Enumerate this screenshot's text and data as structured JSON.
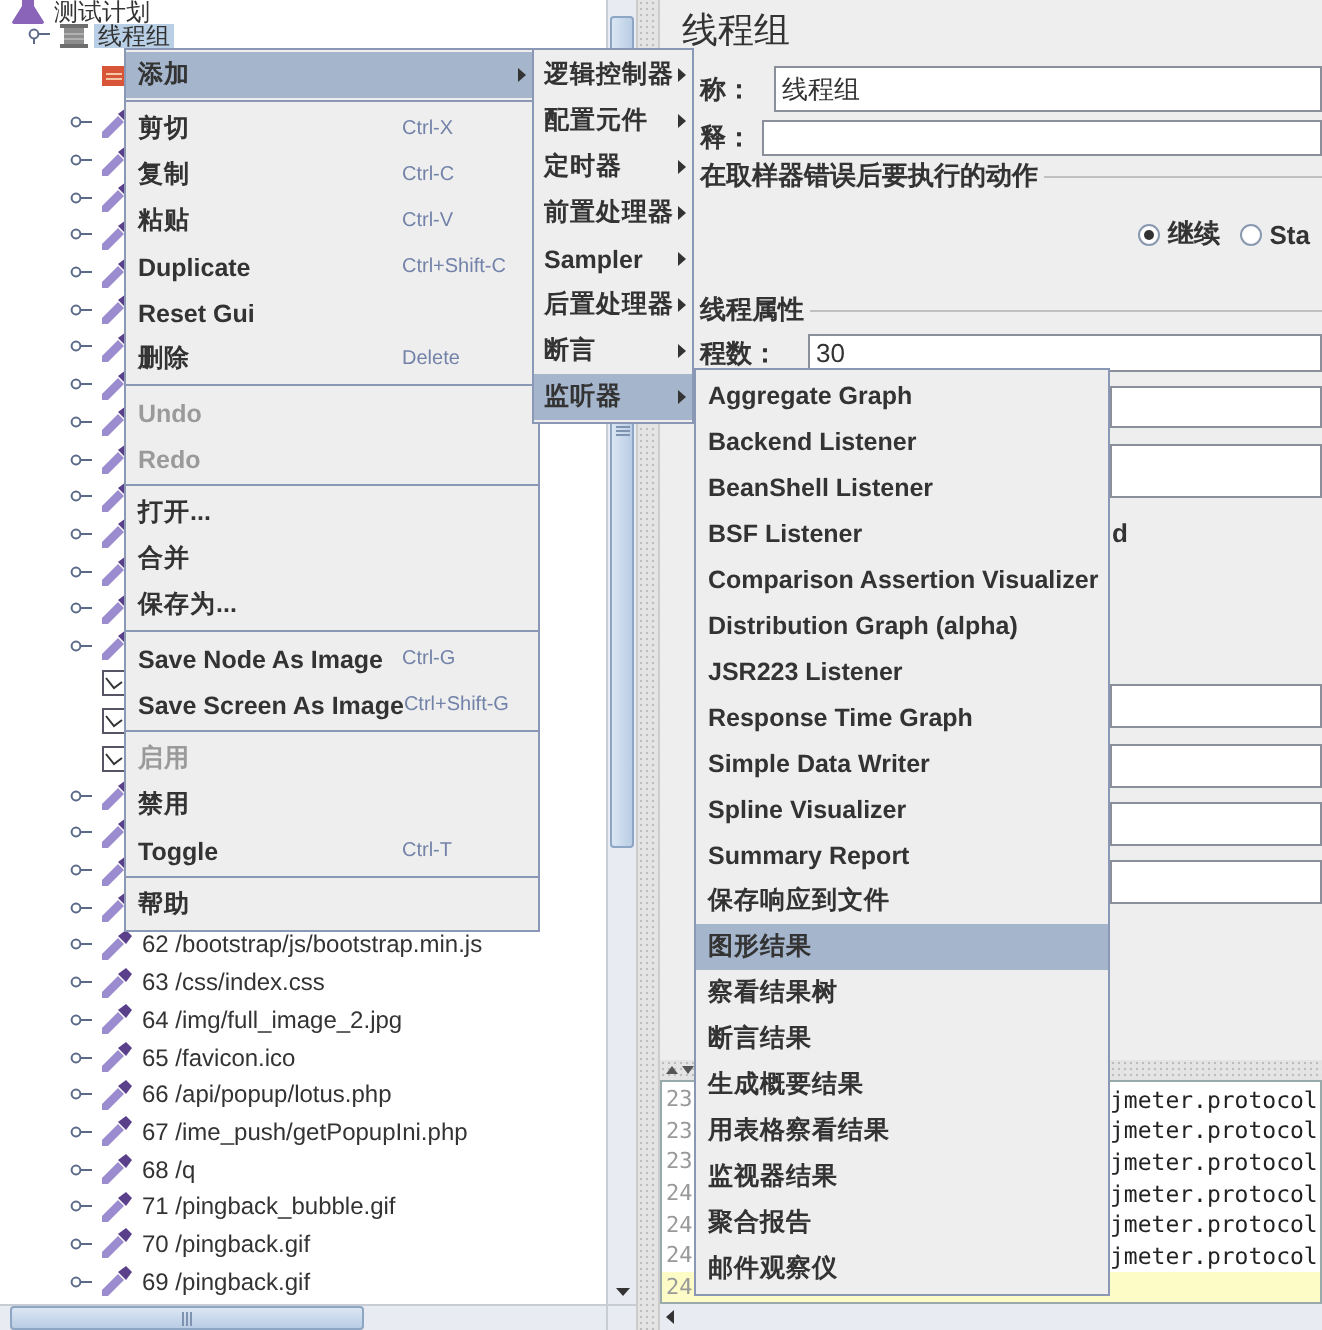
{
  "tree": {
    "root": {
      "label": "测试计划",
      "kind": "plan",
      "selected": false,
      "children": [
        {
          "label": "线程组",
          "kind": "thread_group",
          "selected": true,
          "expanded": true,
          "children": [
            {
              "kind": "config",
              "selected": false
            },
            {
              "kind": "sampler",
              "selected": false,
              "expanded": false
            },
            {
              "kind": "sampler",
              "selected": false,
              "expanded": false
            },
            {
              "kind": "sampler",
              "selected": false,
              "expanded": false
            },
            {
              "kind": "sampler",
              "selected": false,
              "expanded": false
            },
            {
              "kind": "sampler",
              "selected": false,
              "expanded": false
            },
            {
              "kind": "sampler",
              "selected": false,
              "expanded": false
            },
            {
              "kind": "sampler",
              "selected": false,
              "expanded": false
            },
            {
              "kind": "sampler",
              "selected": false,
              "expanded": false
            },
            {
              "kind": "sampler",
              "selected": false,
              "expanded": false
            },
            {
              "kind": "sampler",
              "selected": false,
              "expanded": false
            },
            {
              "kind": "sampler",
              "selected": false,
              "expanded": false
            },
            {
              "kind": "sampler",
              "selected": false,
              "expanded": false
            },
            {
              "kind": "sampler",
              "selected": false,
              "expanded": false
            },
            {
              "kind": "sampler",
              "selected": false,
              "expanded": false
            },
            {
              "kind": "sampler",
              "selected": false,
              "expanded": false
            },
            {
              "kind": "listener",
              "selected": false
            },
            {
              "kind": "listener",
              "selected": false
            },
            {
              "kind": "listener",
              "selected": false
            },
            {
              "kind": "sampler",
              "selected": false,
              "expanded": false
            },
            {
              "kind": "sampler",
              "selected": false,
              "expanded": false
            },
            {
              "kind": "sampler",
              "selected": false,
              "expanded": false
            },
            {
              "kind": "sampler",
              "selected": false,
              "expanded": false
            },
            {
              "kind": "sampler",
              "label": "62 /bootstrap/js/bootstrap.min.js",
              "selected": false,
              "expanded": false
            },
            {
              "kind": "sampler",
              "label": "63 /css/index.css",
              "selected": false,
              "expanded": false
            },
            {
              "kind": "sampler",
              "label": "64 /img/full_image_2.jpg",
              "selected": false,
              "expanded": false
            },
            {
              "kind": "sampler",
              "label": "65 /favicon.ico",
              "selected": false,
              "expanded": false
            },
            {
              "kind": "sampler",
              "label": "66 /api/popup/lotus.php",
              "selected": false,
              "expanded": false
            },
            {
              "kind": "sampler",
              "label": "67 /ime_push/getPopupIni.php",
              "selected": false,
              "expanded": false
            },
            {
              "kind": "sampler",
              "label": "68 /q",
              "selected": false,
              "expanded": false
            },
            {
              "kind": "sampler",
              "label": "71 /pingback_bubble.gif",
              "selected": false,
              "expanded": false
            },
            {
              "kind": "sampler",
              "label": "70 /pingback.gif",
              "selected": false,
              "expanded": false
            },
            {
              "kind": "sampler",
              "label": "69 /pingback.gif",
              "selected": false,
              "expanded": false
            }
          ]
        }
      ]
    }
  },
  "editor": {
    "title": "线程组",
    "name_label": "称：",
    "name_value": "线程组",
    "comment_label": "释：",
    "error_group": {
      "title": "在取样器错误后要执行的动作",
      "options": [
        {
          "label": "继续",
          "selected": true
        },
        {
          "label": "Sta",
          "selected": false
        }
      ]
    },
    "thread_group": {
      "title": "线程属性",
      "threads_label": "程数：",
      "threads_value": "30",
      "fragment": "d"
    }
  },
  "log": {
    "lines": [
      {
        "number": "23",
        "text": "jmeter.protocol",
        "current": false
      },
      {
        "number": "23",
        "text": "jmeter.protocol",
        "current": false
      },
      {
        "number": "23",
        "text": "jmeter.protocol",
        "current": false
      },
      {
        "number": "24",
        "text": "jmeter.protocol",
        "current": false
      },
      {
        "number": "24",
        "text": "jmeter.protocol",
        "current": false
      },
      {
        "number": "24",
        "text": "jmeter.protocol",
        "current": false
      },
      {
        "number": "24",
        "current": true
      }
    ]
  },
  "context_menu": {
    "groups": [
      {
        "items": [
          {
            "label": "添加",
            "selected": true,
            "disabled": false,
            "has_submenu": true
          }
        ]
      },
      {
        "items": [
          {
            "label": "剪切",
            "shortcut": "Ctrl-X",
            "selected": false,
            "disabled": false
          },
          {
            "label": "复制",
            "shortcut": "Ctrl-C",
            "selected": false,
            "disabled": false
          },
          {
            "label": "粘贴",
            "shortcut": "Ctrl-V",
            "selected": false,
            "disabled": false
          },
          {
            "label": "Duplicate",
            "shortcut": "Ctrl+Shift-C",
            "selected": false,
            "disabled": false
          },
          {
            "label": "Reset Gui",
            "selected": false,
            "disabled": false
          },
          {
            "label": "删除",
            "shortcut": "Delete",
            "selected": false,
            "disabled": false
          }
        ]
      },
      {
        "items": [
          {
            "label": "Undo",
            "selected": false,
            "disabled": true
          },
          {
            "label": "Redo",
            "selected": false,
            "disabled": true
          }
        ]
      },
      {
        "items": [
          {
            "label": "打开...",
            "selected": false,
            "disabled": false
          },
          {
            "label": "合并",
            "selected": false,
            "disabled": false
          },
          {
            "label": "保存为...",
            "selected": false,
            "disabled": false
          }
        ]
      },
      {
        "items": [
          {
            "label": "Save Node As Image",
            "shortcut": "Ctrl-G",
            "selected": false,
            "disabled": false
          },
          {
            "label": "Save Screen As Image",
            "shortcut": "Ctrl+Shift-G",
            "selected": false,
            "disabled": false
          }
        ]
      },
      {
        "items": [
          {
            "label": "启用",
            "selected": false,
            "disabled": true
          },
          {
            "label": "禁用",
            "selected": false,
            "disabled": false
          },
          {
            "label": "Toggle",
            "shortcut": "Ctrl-T",
            "selected": false,
            "disabled": false
          }
        ]
      },
      {
        "items": [
          {
            "label": "帮助",
            "selected": false,
            "disabled": false
          }
        ]
      }
    ]
  },
  "add_menu": {
    "items": [
      {
        "label": "逻辑控制器",
        "selected": false,
        "has_submenu": true
      },
      {
        "label": "配置元件",
        "selected": false,
        "has_submenu": true
      },
      {
        "label": "定时器",
        "selected": false,
        "has_submenu": true
      },
      {
        "label": "前置处理器",
        "selected": false,
        "has_submenu": true
      },
      {
        "label": "Sampler",
        "selected": false,
        "has_submenu": true
      },
      {
        "label": "后置处理器",
        "selected": false,
        "has_submenu": true
      },
      {
        "label": "断言",
        "selected": false,
        "has_submenu": true
      },
      {
        "label": "监听器",
        "selected": true,
        "has_submenu": true
      }
    ]
  },
  "listener_menu": {
    "items": [
      {
        "label": "Aggregate Graph",
        "selected": false
      },
      {
        "label": "Backend Listener",
        "selected": false
      },
      {
        "label": "BeanShell Listener",
        "selected": false
      },
      {
        "label": "BSF Listener",
        "selected": false
      },
      {
        "label": "Comparison Assertion Visualizer",
        "selected": false
      },
      {
        "label": "Distribution Graph (alpha)",
        "selected": false
      },
      {
        "label": "JSR223 Listener",
        "selected": false
      },
      {
        "label": "Response Time Graph",
        "selected": false
      },
      {
        "label": "Simple Data Writer",
        "selected": false
      },
      {
        "label": "Spline Visualizer",
        "selected": false
      },
      {
        "label": "Summary Report",
        "selected": false
      },
      {
        "label": "保存响应到文件",
        "selected": false
      },
      {
        "label": "图形结果",
        "selected": true
      },
      {
        "label": "察看结果树",
        "selected": false
      },
      {
        "label": "断言结果",
        "selected": false
      },
      {
        "label": "生成概要结果",
        "selected": false
      },
      {
        "label": "用表格察看结果",
        "selected": false
      },
      {
        "label": "监视器结果",
        "selected": false
      },
      {
        "label": "聚合报告",
        "selected": false
      },
      {
        "label": "邮件观察仪",
        "selected": false
      }
    ]
  }
}
